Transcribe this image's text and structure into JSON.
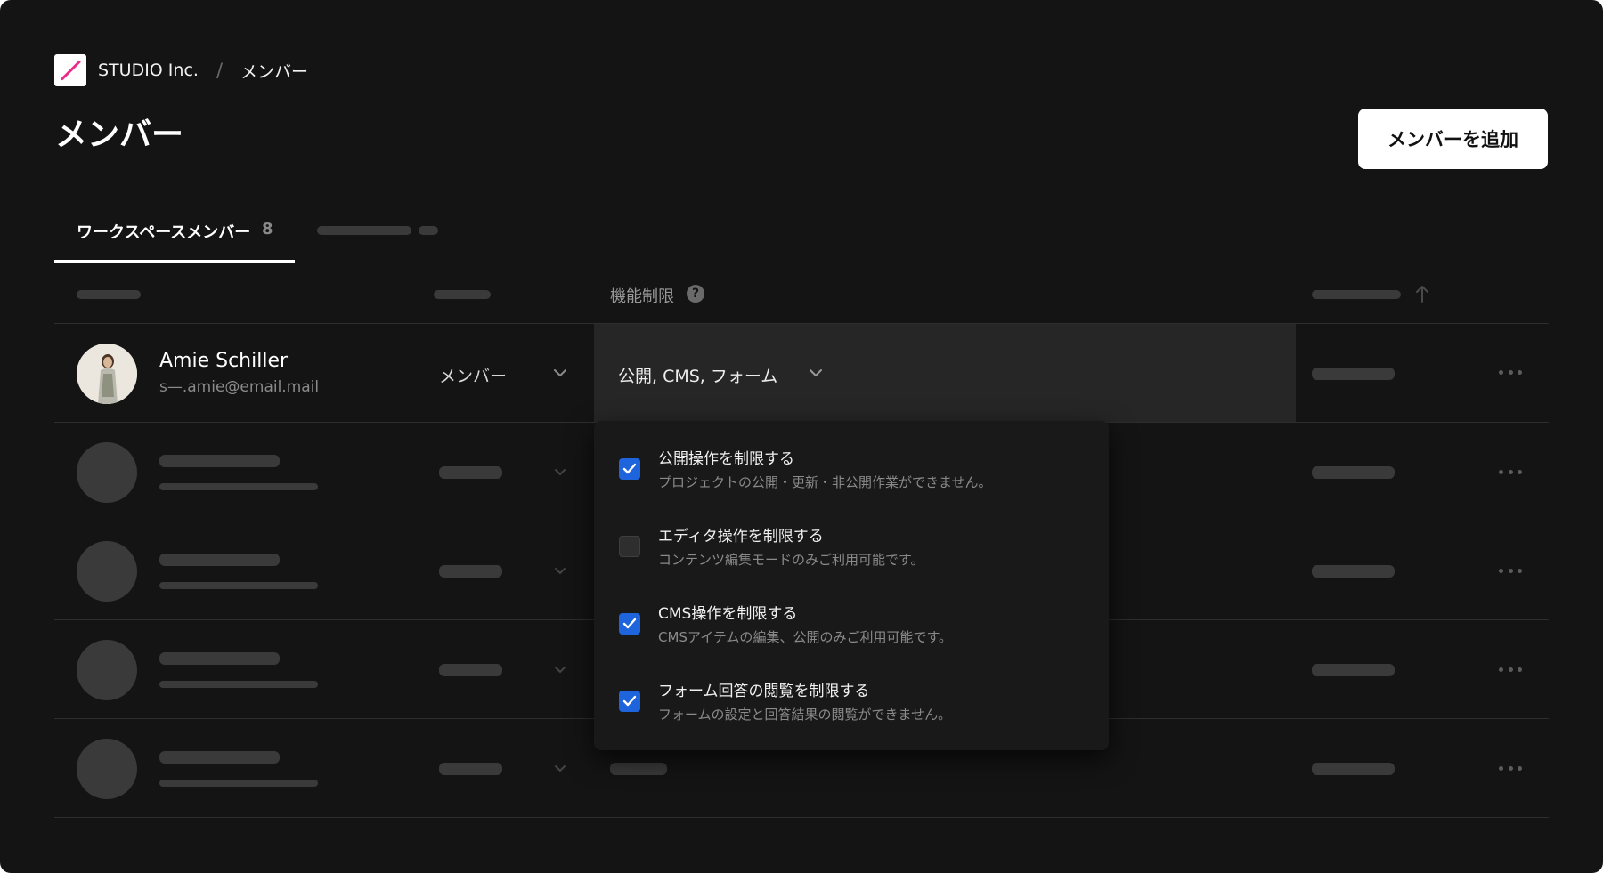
{
  "breadcrumb": {
    "org": "STUDIO Inc.",
    "separator": "/",
    "page": "メンバー"
  },
  "page_title": "メンバー",
  "add_button_label": "メンバーを追加",
  "tabs": [
    {
      "label": "ワークスペースメンバー",
      "count": "8"
    }
  ],
  "table": {
    "headers": {
      "restriction": "機能制限",
      "help": "?"
    }
  },
  "member": {
    "name": "Amie Schiller",
    "email": "s—.amie@email.mail",
    "role": "メンバー",
    "restriction": "公開, CMS, フォーム"
  },
  "restriction_options": [
    {
      "title": "公開操作を制限する",
      "description": "プロジェクトの公開・更新・非公開作業ができません。",
      "checked": true
    },
    {
      "title": "エディタ操作を制限する",
      "description": "コンテンツ編集モードのみご利用可能です。",
      "checked": false
    },
    {
      "title": "CMS操作を制限する",
      "description": "CMSアイテムの編集、公開のみご利用可能です。",
      "checked": true
    },
    {
      "title": "フォーム回答の閲覧を制限する",
      "description": "フォームの設定と回答結果の閲覧ができません。",
      "checked": true
    }
  ],
  "colors": {
    "background": "#141414",
    "accent": "#1e64dc",
    "logo_mark": "#e8308a"
  }
}
